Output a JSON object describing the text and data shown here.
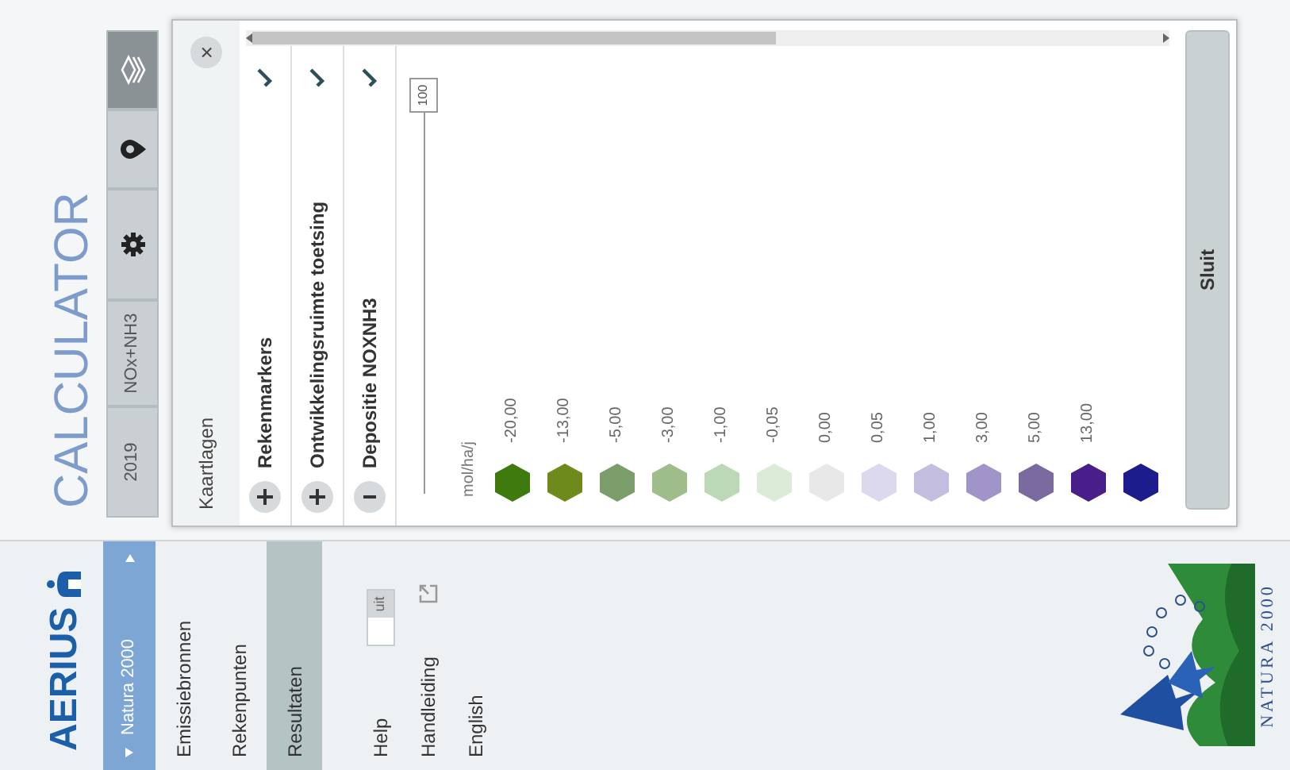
{
  "sidebar": {
    "logo": "AERIUS",
    "dropdown": "Natura 2000",
    "items": [
      {
        "label": "Emissiebronnen",
        "selected": false
      },
      {
        "label": "Rekenpunten",
        "selected": false
      },
      {
        "label": "Resultaten",
        "selected": true
      }
    ],
    "help": {
      "label": "Help",
      "switch": {
        "label": "uit",
        "on": false
      }
    },
    "links": [
      {
        "label": "Handleiding",
        "kind": "external"
      },
      {
        "label": "English",
        "kind": "plain"
      }
    ],
    "partner_logo": {
      "text": "NATURA 2000"
    }
  },
  "header": {
    "title": "CALCULATOR"
  },
  "toolbar": [
    {
      "kind": "text",
      "label": "2019",
      "selected": false
    },
    {
      "kind": "text",
      "label": "NOx+NH3",
      "selected": false
    },
    {
      "kind": "gear",
      "selected": false
    },
    {
      "kind": "pin",
      "selected": false
    },
    {
      "kind": "layers",
      "selected": true
    }
  ],
  "panel": {
    "title": "Kaartlagen",
    "close": "×",
    "layers": [
      {
        "label": "Rekenmarkers",
        "expanded": false,
        "visible": true
      },
      {
        "label": "Ontwikkelingsruimte toetsing",
        "expanded": false,
        "visible": true
      },
      {
        "label": "Depositie NOXNH3",
        "expanded": true,
        "visible": true
      }
    ],
    "opacity": {
      "level": 1,
      "reading": "100"
    },
    "legend": {
      "unit": "mol/ha/j",
      "items": [
        {
          "label": "-20,00",
          "color": "#3f7a0e"
        },
        {
          "label": "-13,00",
          "color": "#6e8a1c"
        },
        {
          "label": "-5,00",
          "color": "#7a9d6a"
        },
        {
          "label": "-3,00",
          "color": "#9dbd8a"
        },
        {
          "label": "-1,00",
          "color": "#bcd9b5"
        },
        {
          "label": "-0,05",
          "color": "#dcebd8"
        },
        {
          "label": "0,00",
          "color": "#e8e8e8"
        },
        {
          "label": "0,05",
          "color": "#dcd8ee"
        },
        {
          "label": "1,00",
          "color": "#c3bddf"
        },
        {
          "label": "3,00",
          "color": "#a094c8"
        },
        {
          "label": "5,00",
          "color": "#7a6aa0"
        },
        {
          "label": "13,00",
          "color": "#4a1e8a"
        },
        {
          "color": "#1c1c8c"
        }
      ]
    },
    "button": "Sluit"
  }
}
